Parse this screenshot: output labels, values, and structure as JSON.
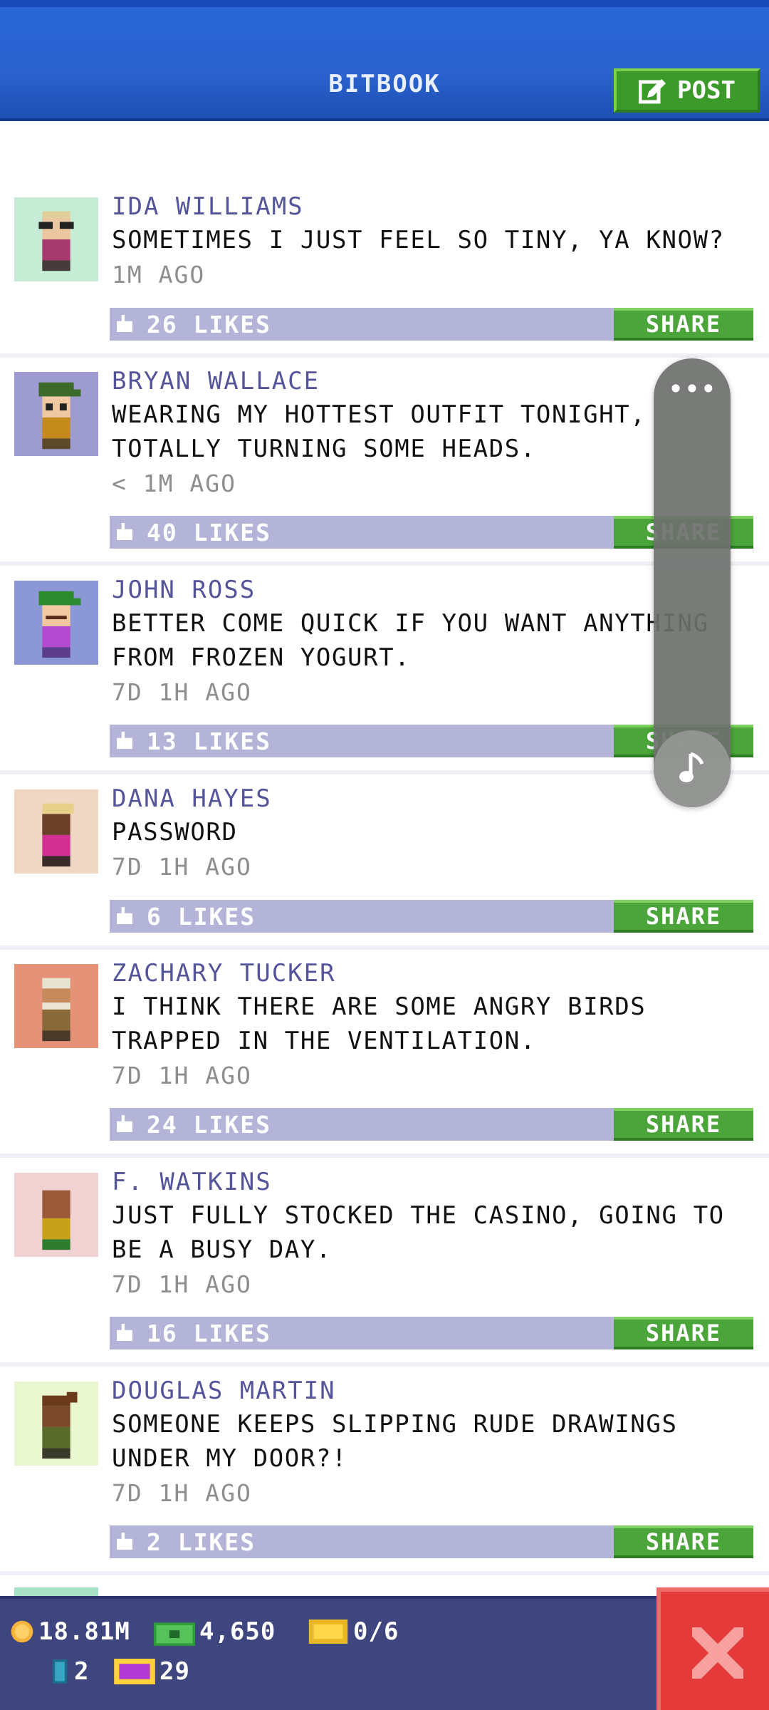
{
  "header": {
    "title": "BITBOOK",
    "post_label": "POST"
  },
  "posts": [
    {
      "name": "IDA WILLIAMS",
      "message": "SOMETIMES I JUST FEEL SO TINY, YA KNOW?",
      "time": "1M AGO",
      "likes": "26 LIKES",
      "share": "SHARE",
      "avatar_bg": "#c6ecd6"
    },
    {
      "name": "BRYAN WALLACE",
      "message": "WEARING MY HOTTEST OUTFIT TONIGHT, TOTALLY TURNING SOME HEADS.",
      "time": "< 1M AGO",
      "likes": "40 LIKES",
      "share": "SHARE",
      "avatar_bg": "#9d9bd0"
    },
    {
      "name": "JOHN ROSS",
      "message": "BETTER COME QUICK IF YOU WANT ANYTHING FROM FROZEN YOGURT.",
      "time": "7D 1H AGO",
      "likes": "13 LIKES",
      "share": "SHARE",
      "avatar_bg": "#8c97d6"
    },
    {
      "name": "DANA HAYES",
      "message": "PASSWORD",
      "time": "7D 1H AGO",
      "likes": "6 LIKES",
      "share": "SHARE",
      "avatar_bg": "#f0d7c4"
    },
    {
      "name": "ZACHARY TUCKER",
      "message": "I THINK THERE ARE SOME ANGRY BIRDS TRAPPED IN THE VENTILATION.",
      "time": "7D 1H AGO",
      "likes": "24 LIKES",
      "share": "SHARE",
      "avatar_bg": "#e59279"
    },
    {
      "name": "F. WATKINS",
      "message": "JUST FULLY STOCKED THE CASINO, GOING TO BE A BUSY DAY.",
      "time": "7D 1H AGO",
      "likes": "16 LIKES",
      "share": "SHARE",
      "avatar_bg": "#f1d2d2"
    },
    {
      "name": "DOUGLAS MARTIN",
      "message": "SOMEONE KEEPS SLIPPING RUDE DRAWINGS UNDER MY DOOR?!",
      "time": "7D 1H AGO",
      "likes": "2 LIKES",
      "share": "SHARE",
      "avatar_bg": "#e9f6cf"
    }
  ],
  "status": {
    "coins": "18.81M",
    "bux": "4,650",
    "tickets": "0/6",
    "items": "2",
    "vip": "29"
  },
  "colors": {
    "header_blue": "#2a66d6",
    "share_green": "#4ba53a",
    "like_bar": "#b3b4d7",
    "name_purple": "#54549a",
    "close_red": "#e43a3a",
    "bottom_bar": "#3f457e"
  },
  "icons": {
    "post": "edit-icon",
    "like": "thumbs-up-icon",
    "overlay_more": "more-dots-icon",
    "overlay_music": "music-note-icon",
    "close": "close-icon",
    "coin": "coin-icon",
    "bux": "bux-icon",
    "ticket": "ticket-icon",
    "item": "item-icon",
    "vip": "vip-icon"
  }
}
